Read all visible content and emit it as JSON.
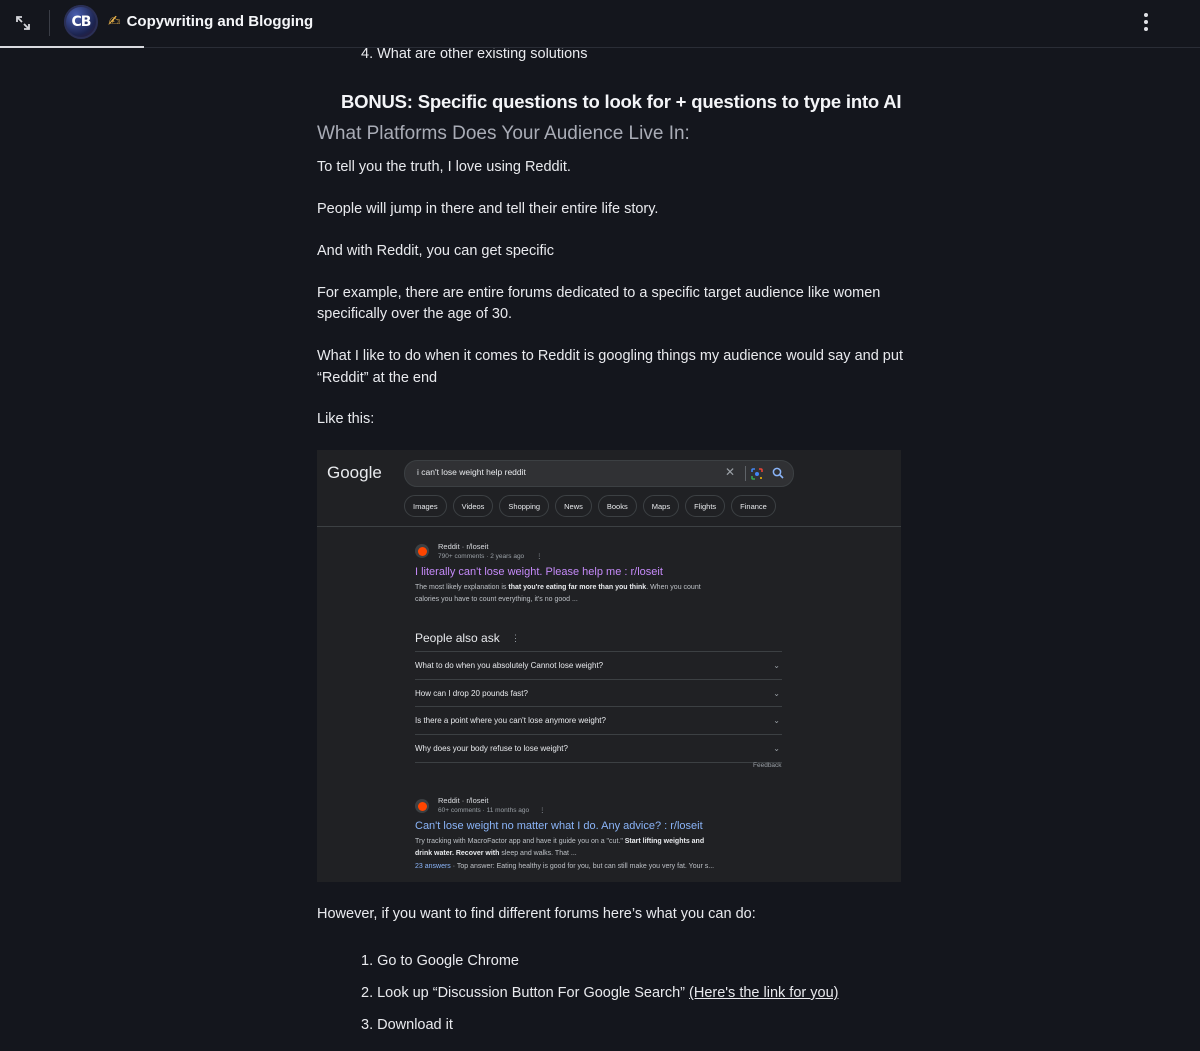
{
  "header": {
    "avatar_text": "CB",
    "title_emoji": "✍",
    "title": "Copywriting and Blogging"
  },
  "article": {
    "list_top_item": "4. What are other existing solutions",
    "bonus_heading": "BONUS: Specific questions to look for + questions to type into AI",
    "section_heading": "What Platforms Does Your Audience Live In:",
    "paragraphs": [
      "To tell you the truth, I love using Reddit.",
      "People will jump in there and tell their entire life story.",
      "And with Reddit, you can get specific",
      "For example, there are entire forums dedicated to a specific target audience like women",
      "specifically over the age of 30.",
      "What I like to do when it comes to Reddit is googling things my audience would say and put",
      "“Reddit” at the end",
      "Like this:",
      "However, if you want to find different forums here’s what you can do:"
    ],
    "steps": [
      "1. Go to Google Chrome",
      "2. Look up “Discussion Button For Google Search” ",
      "3. Download it"
    ],
    "step2_link": "(Here's the link for you)"
  },
  "google": {
    "logo": "Google",
    "query": "i can't lose weight help reddit",
    "chips": [
      "Images",
      "Videos",
      "Shopping",
      "News",
      "Books",
      "Maps",
      "Flights",
      "Finance"
    ],
    "result1": {
      "site": "Reddit · r/loseit",
      "meta": "790+ comments · 2 years ago",
      "title": "I literally can't lose weight. Please help me : r/loseit",
      "snippet_a": "The most likely explanation is ",
      "snippet_bold": "that you're eating far more than you think",
      "snippet_b": ". When you count",
      "snippet_c": "calories you have to count everything, it's no good ..."
    },
    "paa": {
      "title": "People also ask",
      "questions": [
        "What to do when you absolutely Cannot lose weight?",
        "How can I drop 20 pounds fast?",
        "Is there a point where you can't lose anymore weight?",
        "Why does your body refuse to lose weight?"
      ],
      "feedback": "Feedback"
    },
    "result2": {
      "site": "Reddit · r/loseit",
      "meta": "60+ comments · 11 months ago",
      "title": "Can't lose weight no matter what I do. Any advice? : r/loseit",
      "snippet_a": "Try tracking with MacroFactor app and have it guide you on a \"cut.\" ",
      "snippet_bold1": "Start lifting weights and",
      "snippet_bold2": "drink water. Recover with",
      "snippet_b": " sleep and walks. That ...",
      "answers": "23 answers",
      "answers_rest": " · Top answer: Eating healthy is good for you, but can still make you very fat. Your s..."
    },
    "colors": {
      "visited_link": "#c58af9",
      "link": "#8ab4f8"
    }
  },
  "icons": {
    "expand": "expand-icon",
    "kebab": "kebab-menu-icon",
    "reddit": "reddit-icon",
    "lens": "google-lens-icon",
    "search": "search-icon",
    "clear": "clear-icon",
    "chevron": "chevron-down-icon"
  }
}
